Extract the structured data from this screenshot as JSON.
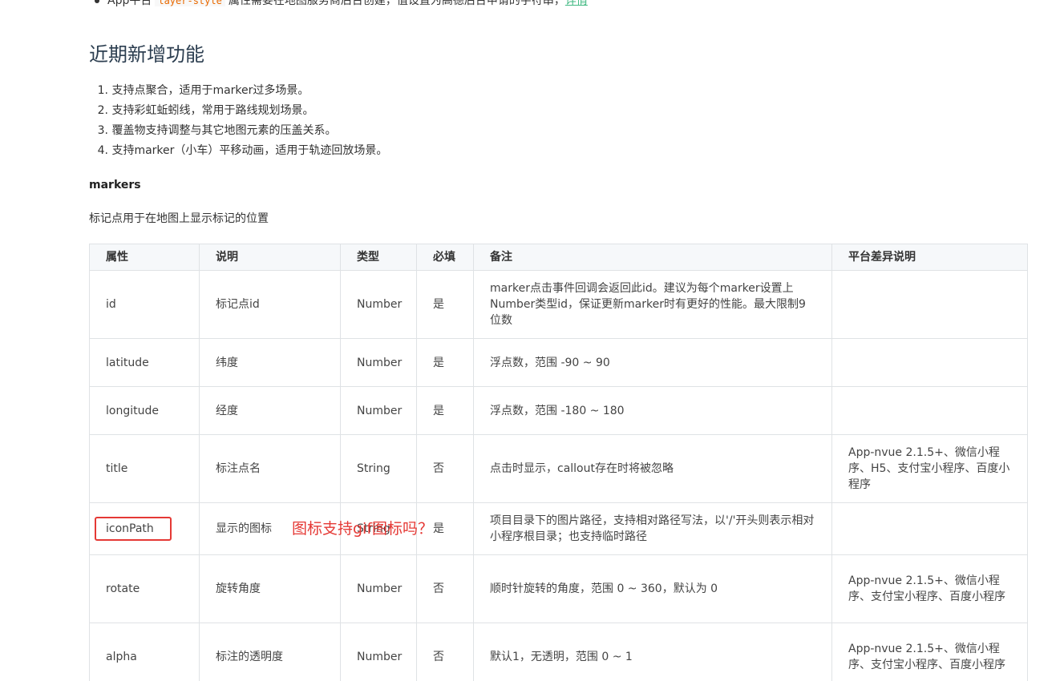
{
  "top_note": {
    "prefix": "App平台",
    "code": "layer-style",
    "text": "属性需要在地图服务商后台创建，值设置为高德后台申请的字符串，",
    "link": "详情"
  },
  "section_title": "近期新增功能",
  "features": [
    {
      "num": "1.",
      "text": "支持点聚合，适用于marker过多场景。"
    },
    {
      "num": "2.",
      "text": "支持彩虹蚯蚓线，常用于路线规划场景。"
    },
    {
      "num": "3.",
      "text": "覆盖物支持调整与其它地图元素的压盖关系。"
    },
    {
      "num": "4.",
      "text": "支持marker（小车）平移动画，适用于轨迹回放场景。"
    }
  ],
  "subheading": "markers",
  "description": "标记点用于在地图上显示标记的位置",
  "table": {
    "headers": [
      "属性",
      "说明",
      "类型",
      "必填",
      "备注",
      "平台差异说明"
    ],
    "rows": [
      {
        "attr": "id",
        "desc": "标记点id",
        "type": "Number",
        "required": "是",
        "note": "marker点击事件回调会返回此id。建议为每个marker设置上Number类型id，保证更新marker时有更好的性能。最大限制9位数",
        "platform": ""
      },
      {
        "attr": "latitude",
        "desc": "纬度",
        "type": "Number",
        "required": "是",
        "note": "浮点数，范围 -90 ~ 90",
        "platform": ""
      },
      {
        "attr": "longitude",
        "desc": "经度",
        "type": "Number",
        "required": "是",
        "note": "浮点数，范围 -180 ~ 180",
        "platform": ""
      },
      {
        "attr": "title",
        "desc": "标注点名",
        "type": "String",
        "required": "否",
        "note": "点击时显示，callout存在时将被忽略",
        "platform": "App-nvue 2.1.5+、微信小程序、H5、支付宝小程序、百度小程序"
      },
      {
        "attr": "iconPath",
        "desc": "显示的图标",
        "type": "String",
        "required": "是",
        "note": "项目目录下的图片路径，支持相对路径写法，以'/'开头则表示相对小程序根目录；也支持临时路径",
        "platform": ""
      },
      {
        "attr": "rotate",
        "desc": "旋转角度",
        "type": "Number",
        "required": "否",
        "note": "顺时针旋转的角度，范围 0 ~ 360，默认为 0",
        "platform": "App-nvue 2.1.5+、微信小程序、支付宝小程序、百度小程序"
      },
      {
        "attr": "alpha",
        "desc": "标注的透明度",
        "type": "Number",
        "required": "否",
        "note": "默认1，无透明，范围 0 ~ 1",
        "platform": "App-nvue 2.1.5+、微信小程序、支付宝小程序、百度小程序"
      }
    ]
  },
  "annotation": {
    "text": "图标支持gif图标吗？",
    "color": "#e53935"
  }
}
